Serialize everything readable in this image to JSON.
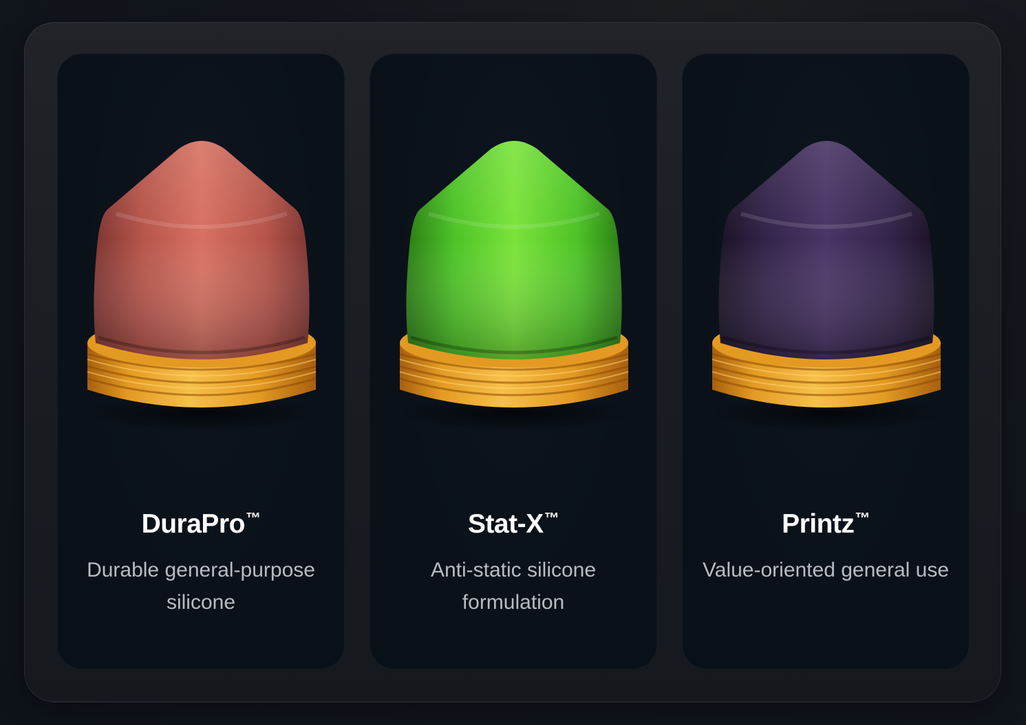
{
  "products": [
    {
      "name": "DuraPro",
      "trademark": "™",
      "description": "Durable general-purpose silicone",
      "icon": "pad-printing-pad-icon",
      "colors": {
        "top": "#d77162",
        "mid": "#b5544a",
        "dark": "#7e3531"
      }
    },
    {
      "name": "Stat-X",
      "trademark": "™",
      "description": "Anti-static silicone formulation",
      "icon": "pad-printing-pad-icon",
      "colors": {
        "top": "#7ae33a",
        "mid": "#4cc226",
        "dark": "#2b7d14"
      }
    },
    {
      "name": "Printz",
      "trademark": "™",
      "description": "Value-oriented general use",
      "icon": "pad-printing-pad-icon",
      "colors": {
        "top": "#4a3566",
        "mid": "#33244a",
        "dark": "#1a1226"
      }
    }
  ],
  "base_colors": {
    "light": "#f7c04a",
    "mid": "#e49a22",
    "dark": "#a8600e"
  }
}
